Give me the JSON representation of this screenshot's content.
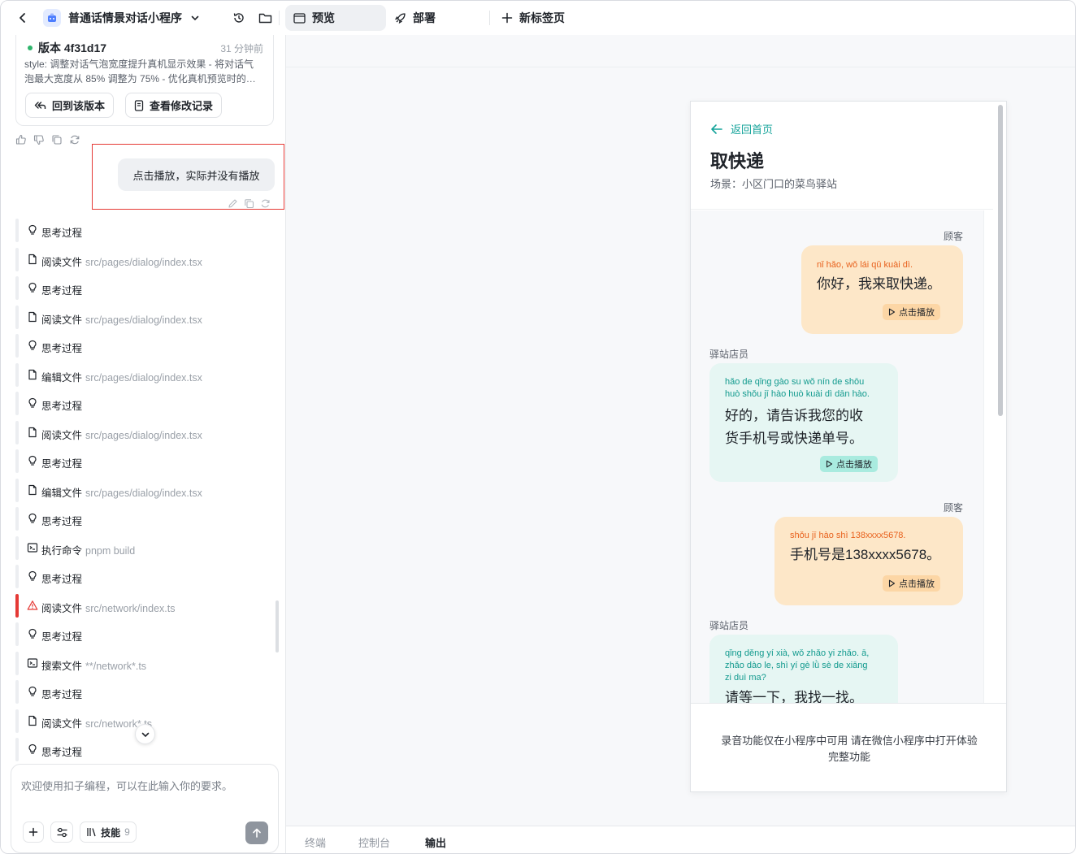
{
  "topbar": {
    "project_title": "普通话情景对话小程序",
    "tabs": [
      {
        "label": "预览"
      },
      {
        "label": "部署"
      },
      {
        "label": "新标签页"
      }
    ]
  },
  "version_card": {
    "title": "版本 4f31d17",
    "time": "31 分钟前",
    "description_line1": "style: 调整对话气泡宽度提升真机显示效果 - 将对话气",
    "description_line2": "泡最大宽度从 85% 调整为 75% - 优化真机预览时的…",
    "revert_label": "回到该版本",
    "changes_label": "查看修改记录"
  },
  "user_message": {
    "text": "点击播放，实际并没有播放"
  },
  "steps": [
    {
      "type": "think",
      "label": "思考过程",
      "path": ""
    },
    {
      "type": "file",
      "label": "阅读文件",
      "path": "src/pages/dialog/index.tsx"
    },
    {
      "type": "think",
      "label": "思考过程",
      "path": ""
    },
    {
      "type": "file",
      "label": "阅读文件",
      "path": "src/pages/dialog/index.tsx"
    },
    {
      "type": "think",
      "label": "思考过程",
      "path": ""
    },
    {
      "type": "file",
      "label": "编辑文件",
      "path": "src/pages/dialog/index.tsx"
    },
    {
      "type": "think",
      "label": "思考过程",
      "path": ""
    },
    {
      "type": "file",
      "label": "阅读文件",
      "path": "src/pages/dialog/index.tsx"
    },
    {
      "type": "think",
      "label": "思考过程",
      "path": ""
    },
    {
      "type": "file",
      "label": "编辑文件",
      "path": "src/pages/dialog/index.tsx"
    },
    {
      "type": "think",
      "label": "思考过程",
      "path": ""
    },
    {
      "type": "term",
      "label": "执行命令",
      "path": "pnpm build"
    },
    {
      "type": "think",
      "label": "思考过程",
      "path": ""
    },
    {
      "type": "warn",
      "label": "阅读文件",
      "path": "src/network/index.ts"
    },
    {
      "type": "think",
      "label": "思考过程",
      "path": ""
    },
    {
      "type": "term",
      "label": "搜索文件",
      "path": "**/network*.ts"
    },
    {
      "type": "think",
      "label": "思考过程",
      "path": ""
    },
    {
      "type": "file",
      "label": "阅读文件",
      "path": "src/network*.ts"
    },
    {
      "type": "think",
      "label": "思考过程",
      "path": ""
    }
  ],
  "input": {
    "placeholder": "欢迎使用扣子编程，可以在此输入你的要求。",
    "skill_label": "技能",
    "skill_count": "9"
  },
  "bottom_tabs": [
    {
      "label": "终端"
    },
    {
      "label": "控制台"
    },
    {
      "label": "输出"
    }
  ],
  "phone": {
    "back_label": "返回首页",
    "title": "取快递",
    "scene": "场景：小区门口的菜鸟驿站",
    "play_label": "点击播放",
    "messages": [
      {
        "role": "顾客",
        "pinyin": "nǐ hǎo, wǒ lái qǔ kuài dì.",
        "pinyin2": "",
        "pinyin3": "",
        "hanzi": "你好，我来取快递。",
        "hanzi2": ""
      },
      {
        "role": "驿站店员",
        "pinyin": "hǎo de qǐng gào su wǒ nín de shōu",
        "pinyin2": "huò shǒu jī hào huò kuài dì dān hào.",
        "pinyin3": "",
        "hanzi": "好的，请告诉我您的收",
        "hanzi2": "货手机号或快递单号。"
      },
      {
        "role": "顾客",
        "pinyin": "shǒu jī hào shì 138xxxx5678.",
        "pinyin2": "",
        "pinyin3": "",
        "hanzi": "手机号是138xxxx5678。",
        "hanzi2": ""
      },
      {
        "role": "驿站店员",
        "pinyin": "qǐng děng yí xià, wǒ zhǎo yi zhǎo. ā,",
        "pinyin2": "zhǎo dào le, shì yí gè lǜ sè de xiāng",
        "pinyin3": "zi duì ma?",
        "hanzi": "请等一下，我找一找。",
        "hanzi2": ""
      }
    ],
    "footer_line1": "录音功能仅在小程序中可用 请在微信小程序中打开体验",
    "footer_line2": "完整功能"
  }
}
